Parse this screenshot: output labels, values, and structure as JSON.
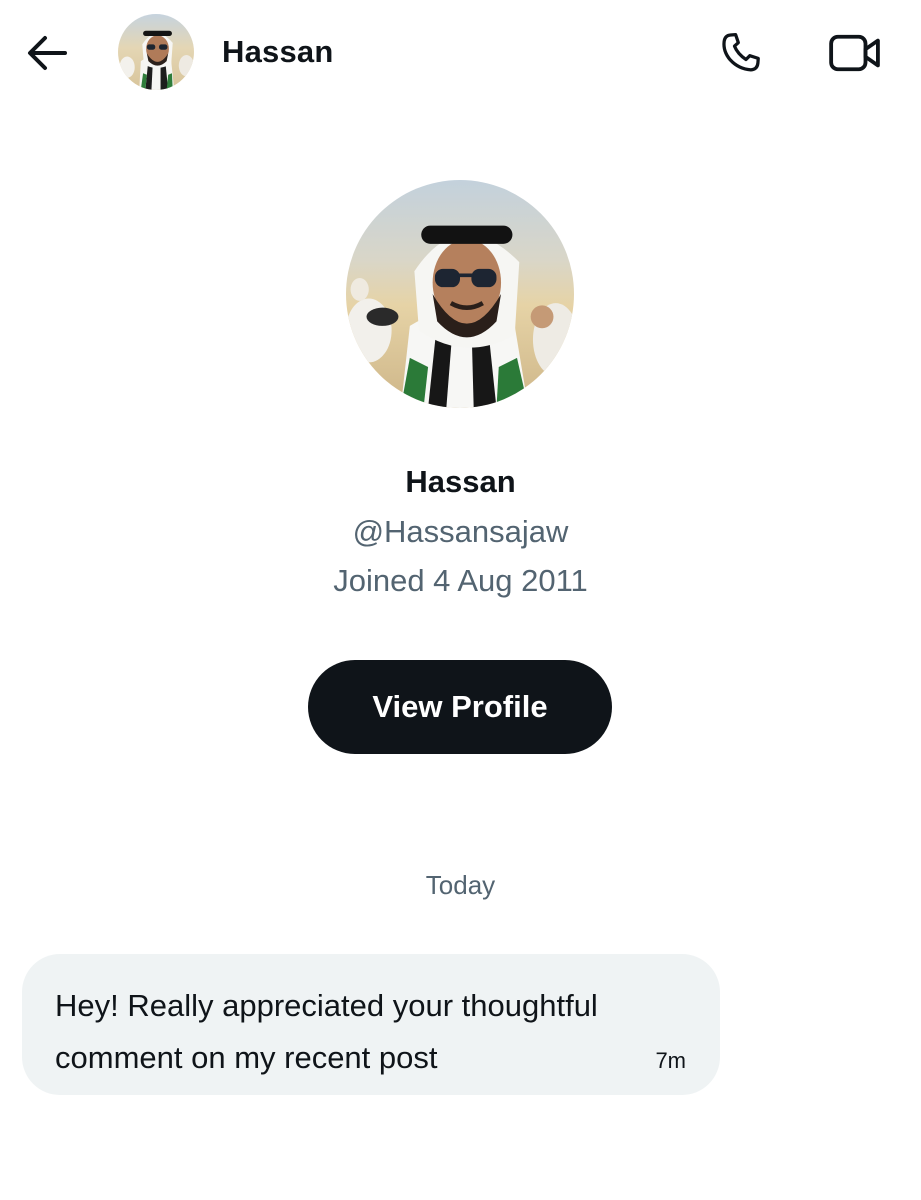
{
  "header": {
    "contact_name": "Hassan",
    "back_icon": "arrow-left-icon",
    "call_icon": "phone-icon",
    "video_icon": "video-camera-icon"
  },
  "profile": {
    "name": "Hassan",
    "handle": "@Hassansajaw",
    "joined": "Joined 4 Aug 2011",
    "view_profile_label": "View Profile"
  },
  "conversation": {
    "date_label": "Today",
    "messages": [
      {
        "text": "Hey! Really appreciated your thoughtful comment on my recent post",
        "time": "7m"
      }
    ]
  },
  "colors": {
    "text_primary": "#0f1419",
    "text_secondary": "#536471",
    "bubble_bg": "#eff3f4",
    "button_bg": "#0f1419"
  }
}
